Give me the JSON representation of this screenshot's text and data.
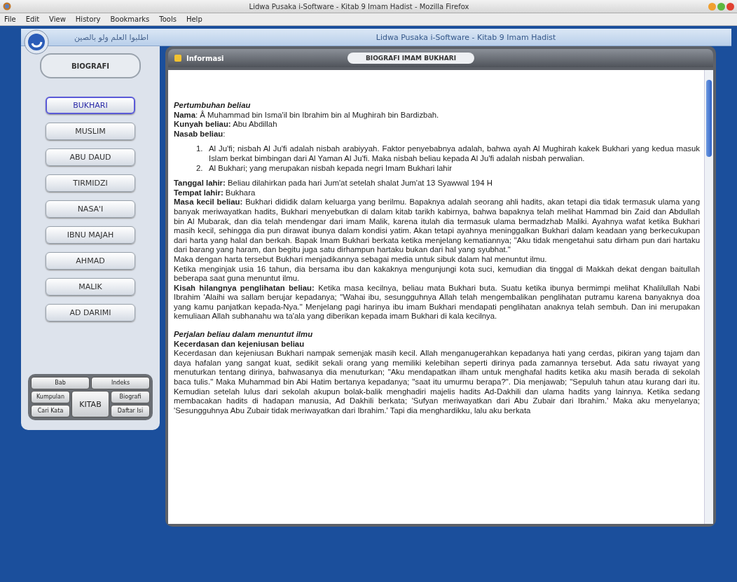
{
  "window": {
    "title": "Lidwa Pusaka i-Software - Kitab 9 Imam Hadist - Mozilla Firefox"
  },
  "menu": [
    "File",
    "Edit",
    "View",
    "History",
    "Bookmarks",
    "Tools",
    "Help"
  ],
  "app": {
    "motto": "اطلبوا العلم ولو بالصين",
    "title": "Lidwa Pusaka i-Software - Kitab 9 Imam Hadist"
  },
  "sidebar": {
    "section": "BIOGRAFI",
    "items": [
      {
        "label": "BUKHARI",
        "selected": true
      },
      {
        "label": "MUSLIM",
        "selected": false
      },
      {
        "label": "ABU DAUD",
        "selected": false
      },
      {
        "label": "TIRMIDZI",
        "selected": false
      },
      {
        "label": "NASA'I",
        "selected": false
      },
      {
        "label": "IBNU MAJAH",
        "selected": false
      },
      {
        "label": "AHMAD",
        "selected": false
      },
      {
        "label": "MALIK",
        "selected": false
      },
      {
        "label": "AD DARIMI",
        "selected": false
      }
    ],
    "tools": [
      {
        "label": "Bab",
        "kind": "wide"
      },
      {
        "label": "Indeks",
        "kind": "wide"
      },
      {
        "label": "Kumpulan",
        "kind": "side"
      },
      {
        "label": "KITAB",
        "kind": "main"
      },
      {
        "label": "Biografi",
        "kind": "side"
      },
      {
        "label": "Cari Kata",
        "kind": "side"
      },
      {
        "label": "Daftar Isi",
        "kind": "side"
      }
    ]
  },
  "panel": {
    "title": "Informasi",
    "tab": "BIOGRAFI IMAM BUKHARI",
    "content": [
      {
        "kind": "heading",
        "text": "Pertumbuhan beliau"
      },
      {
        "kind": "para",
        "text": "**Nama**: Â Muhammad bin Isma'il bin Ibrahim bin al Mughirah bin Bardizbah."
      },
      {
        "kind": "para",
        "text": "**Kunyah beliau:** Abu Abdillah"
      },
      {
        "kind": "para",
        "text": "**Nasab beliau**:"
      },
      {
        "kind": "list",
        "items": [
          {
            "marker": "1.",
            "text": "Al Ju'fi; nisbah Al Ju'fi adalah nisbah arabiyyah. Faktor penyebabnya adalah, bahwa ayah Al Mughirah kakek Bukhari yang kedua masuk Islam berkat bimbingan dari Al Yaman Al Ju'fi. Maka nisbah beliau kepada Al Ju'fi adalah nisbah perwalian."
          },
          {
            "marker": "2.",
            "text": "Al Bukhari; yang merupakan nisbah kepada negri Imam Bukhari lahir"
          }
        ]
      },
      {
        "kind": "para",
        "text": "**Tanggal lahir:** Beliau dilahirkan pada hari Jum'at setelah shalat Jum'at 13 Syawwal 194 H"
      },
      {
        "kind": "para",
        "text": "**Tempat lahir:** Bukhara"
      },
      {
        "kind": "para",
        "text": "**Masa kecil beliau:** Bukhari dididik dalam keluarga yang berilmu. Bapaknya adalah seorang ahli hadits, akan tetapi dia tidak termasuk ulama yang banyak meriwayatkan hadits, Bukhari menyebutkan di dalam kitab tarikh kabirnya, bahwa bapaknya telah melihat Hammad bin Zaid dan Abdullah bin Al Mubarak, dan dia telah mendengar dari imam Malik, karena itulah dia termasuk ulama bermadzhab Maliki. Ayahnya wafat ketika Bukhari masih kecil, sehingga dia pun dirawat ibunya dalam kondisi yatim. Akan tetapi ayahnya meninggalkan Bukhari dalam keadaan yang berkecukupan dari harta yang halal dan berkah. Bapak Imam Bukhari berkata ketika menjelang kematiannya; \"Aku tidak mengetahui satu dirham pun dari hartaku dari barang yang haram, dan begitu juga satu dirhampun hartaku bukan dari hal yang syubhat.\""
      },
      {
        "kind": "para",
        "text": "Maka dengan harta tersebut Bukhari menjadikannya sebagai media untuk sibuk dalam hal menuntut ilmu."
      },
      {
        "kind": "para",
        "text": "Ketika menginjak usia 16 tahun, dia bersama ibu dan kakaknya mengunjungi kota suci, kemudian dia tinggal di Makkah dekat dengan baitullah beberapa saat guna menuntut ilmu."
      },
      {
        "kind": "para",
        "text": "**Kisah hilangnya penglihatan beliau:** Ketika masa kecilnya, beliau mata Bukhari buta. Suatu ketika ibunya bermimpi melihat Khalilullah Nabi Ibrahim 'Alaihi wa sallam berujar kepadanya; \"Wahai ibu, sesungguhnya Allah telah mengembalikan penglihatan putramu karena banyaknya doa yang kamu panjatkan kepada-Nya.\" Menjelang pagi harinya ibu imam Bukhari mendapati penglihatan anaknya telah sembuh. Dan ini merupakan kemuliaan Allah subhanahu wa ta'ala yang diberikan kepada imam Bukhari di kala kecilnya."
      },
      {
        "kind": "heading",
        "text": "Perjalan beliau dalam menuntut ilmu"
      },
      {
        "kind": "subheading",
        "text": "Kecerdasan dan kejeniusan beliau"
      },
      {
        "kind": "para",
        "text": "Kecerdasan dan kejeniusan Bukhari nampak semenjak masih kecil. Allah menganugerahkan kepadanya hati yang cerdas, pikiran yang tajam dan daya hafalan yang sangat kuat, sedikit sekali orang yang memiliki kelebihan seperti dirinya pada zamannya tersebut. Ada satu riwayat yang menuturkan tentang dirinya, bahwasanya dia menuturkan; \"Aku mendapatkan ilham untuk menghafal hadits ketika aku masih berada di sekolah baca tulis.\" Maka Muhammad bin Abi Hatim bertanya kepadanya; \"saat itu umurmu berapa?\". Dia menjawab; \"Sepuluh tahun atau kurang dari itu. Kemudian setelah lulus dari sekolah akupun bolak-balik menghadiri majelis hadits Ad-Dakhili dan ulama hadits yang lainnya. Ketika sedang membacakan hadits di hadapan manusia, Ad Dakhili berkata; 'Sufyan meriwayatkan dari Abu Zubair dari Ibrahim.' Maka aku menyelanya; 'Sesungguhnya Abu Zubair tidak meriwayatkan dari Ibrahim.' Tapi dia menghardikku, lalu aku berkata"
      }
    ]
  }
}
